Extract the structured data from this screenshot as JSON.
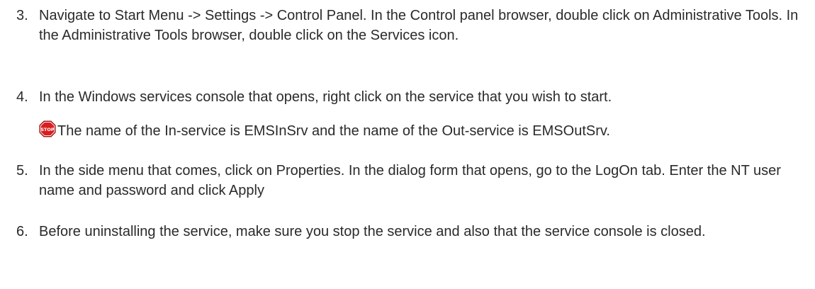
{
  "steps": [
    {
      "number": "3.",
      "text": "Navigate to Start Menu -> Settings -> Control Panel. In the Control panel browser, double click on Administrative Tools. In the Administrative Tools browser, double click on the Services icon."
    },
    {
      "number": "4.",
      "text": "In the Windows services console that opens, right click on the service that you wish to start."
    },
    {
      "number": "5.",
      "text": "In the side menu that comes, click on Properties. In the dialog form that opens, go to the LogOn tab. Enter the NT user name and password and click Apply"
    },
    {
      "number": "6.",
      "text": "Before uninstalling the service, make sure you stop the service and also that the service console is closed."
    }
  ],
  "note": {
    "icon": "stop-sign-icon",
    "icon_label": "STOP",
    "text": "The name of the In-service is EMSInSrv and the name of the Out-service is EMSOutSrv."
  },
  "colors": {
    "text": "#2a2a2a",
    "stop_red": "#d81e1e"
  }
}
